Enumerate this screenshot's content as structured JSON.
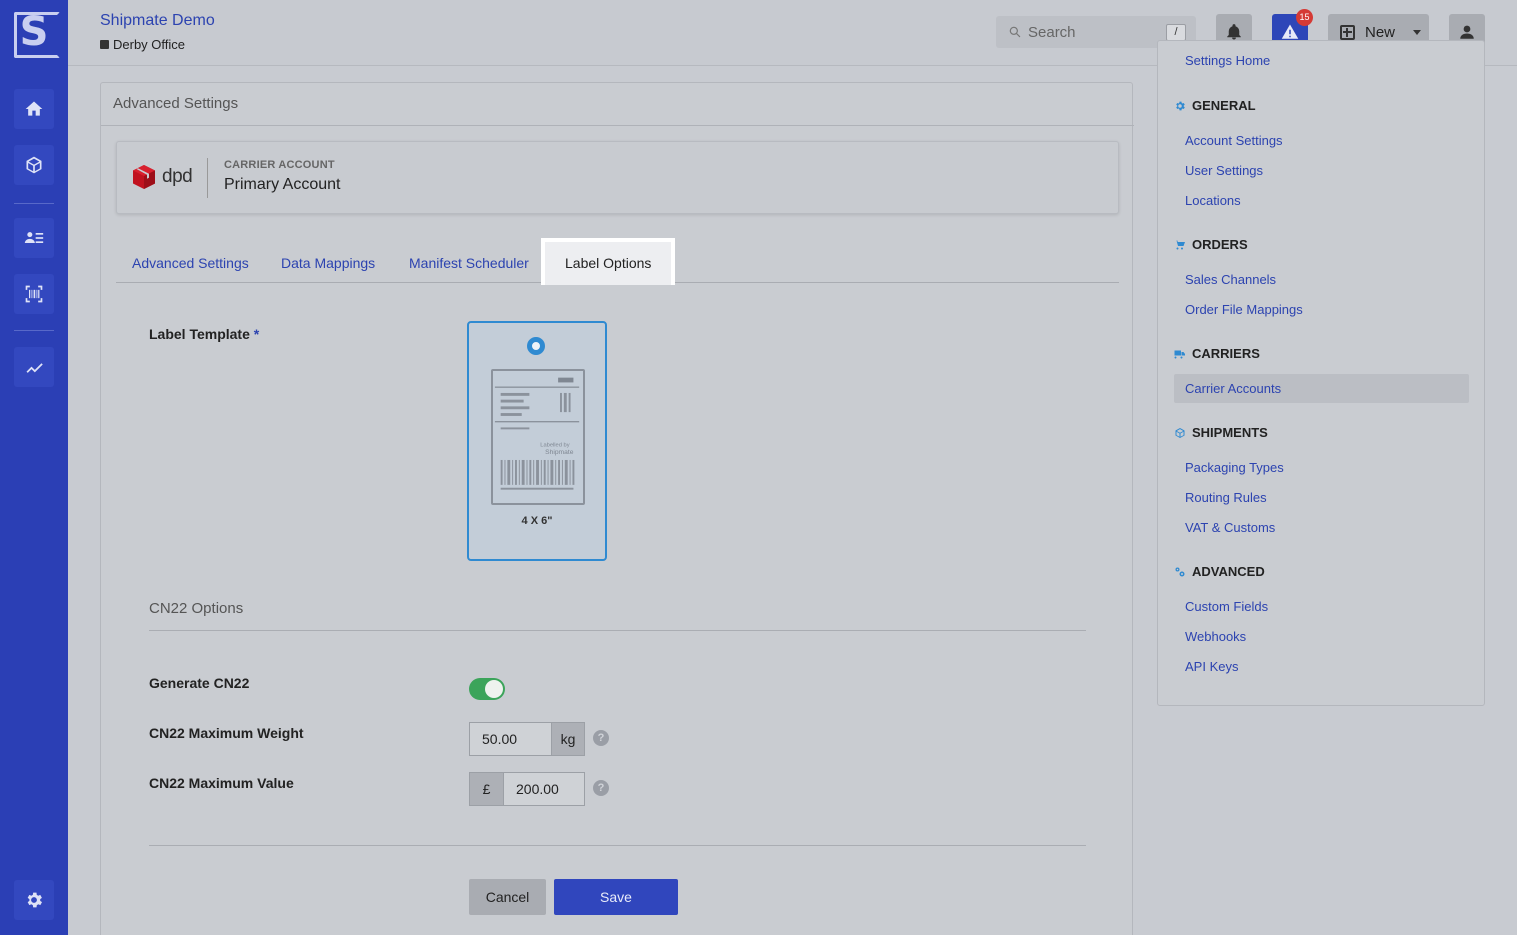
{
  "header": {
    "brand": "Shipmate Demo",
    "office": "Derby Office",
    "search_placeholder": "Search",
    "search_shortcut": "/",
    "alert_count": "15",
    "new_label": "New"
  },
  "card": {
    "title": "Advanced Settings",
    "carrier_logo": "dpd",
    "carrier_account_label": "CARRIER ACCOUNT",
    "carrier_account_name": "Primary Account"
  },
  "tabs": [
    {
      "label": "Advanced Settings"
    },
    {
      "label": "Data Mappings"
    },
    {
      "label": "Manifest Scheduler"
    },
    {
      "label": "Label Options",
      "active": true
    }
  ],
  "form": {
    "label_template_label": "Label Template",
    "required_marker": "*",
    "template": {
      "caption": "4 X 6\"",
      "print_text_1": "Labelled by",
      "print_text_2": "Shipmate"
    },
    "cn22_section_title": "CN22 Options",
    "generate_cn22_label": "Generate CN22",
    "generate_cn22_enabled": true,
    "max_weight_label": "CN22 Maximum Weight",
    "max_weight_value": "50.00",
    "max_weight_unit": "kg",
    "max_value_label": "CN22 Maximum Value",
    "max_value_currency": "£",
    "max_value_value": "200.00",
    "help_glyph": "?",
    "cancel_label": "Cancel",
    "save_label": "Save"
  },
  "right_nav": {
    "cut_item": "Settings Home",
    "sections": [
      {
        "title": "GENERAL",
        "icon": "gear-icon",
        "items": [
          "Account Settings",
          "User Settings",
          "Locations"
        ]
      },
      {
        "title": "ORDERS",
        "icon": "cart-icon",
        "items": [
          "Sales Channels",
          "Order File Mappings"
        ]
      },
      {
        "title": "CARRIERS",
        "icon": "truck-icon",
        "items": [
          "Carrier Accounts"
        ]
      },
      {
        "title": "SHIPMENTS",
        "icon": "box-icon",
        "items": [
          "Packaging Types",
          "Routing Rules",
          "VAT & Customs"
        ]
      },
      {
        "title": "ADVANCED",
        "icon": "gears-icon",
        "items": [
          "Custom Fields",
          "Webhooks",
          "API Keys"
        ]
      }
    ],
    "active_item": "Carrier Accounts"
  },
  "colors": {
    "rail": "#2b3fb5",
    "link": "#2c43b0",
    "accent_blue": "#2f8ad1",
    "toggle_on": "#3ba45a",
    "alert_badge": "#d53a35",
    "dpd_red": "#c1121f"
  }
}
